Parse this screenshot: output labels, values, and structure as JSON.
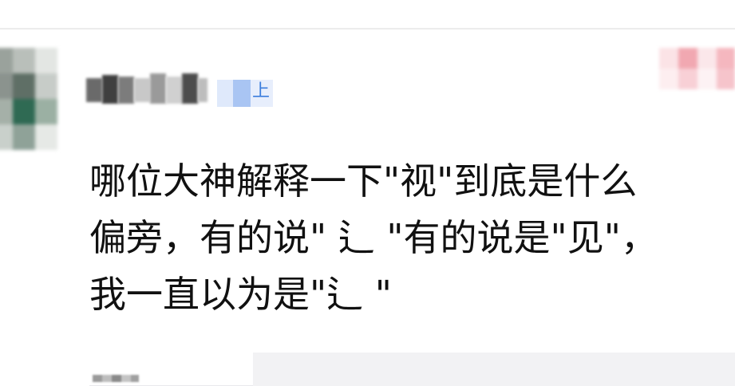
{
  "post": {
    "content_lines": [
      "哪位大神解释一下\"视\"到底是什么",
      "偏旁，有的说\" ⻍ \"有的说是\"见\"，",
      "我一直以为是\"⻍ \""
    ]
  },
  "level_badge": {
    "text": "上",
    "color": "#3b7ddd"
  },
  "colors": {
    "text": "#111111",
    "divider": "#ececec",
    "card_background": "#f2f2f4"
  }
}
